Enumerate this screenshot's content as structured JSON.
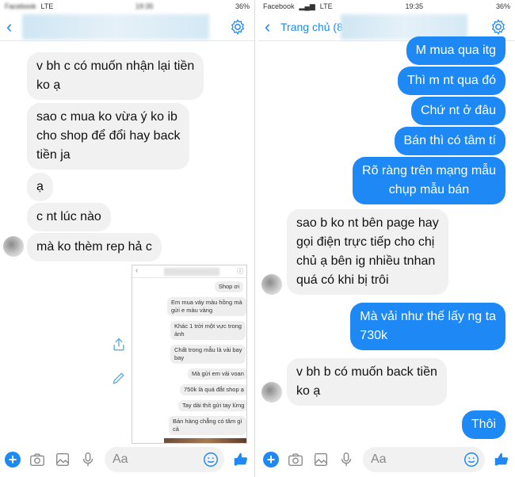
{
  "left": {
    "status": {
      "carrier": "Facebook",
      "network": "LTE",
      "time": "19:35",
      "battery": "36%"
    },
    "messages": [
      {
        "text": [
          "v bh c có muốn nhận lại tiền",
          "ko ạ"
        ]
      },
      {
        "text": [
          "sao c mua ko vừa ý ko ib",
          "cho shop để đổi hay back",
          "tiền ja"
        ]
      },
      {
        "text": [
          "ạ"
        ]
      },
      {
        "text": [
          "c nt lúc nào"
        ]
      },
      {
        "text": [
          "mà ko thèm rep hả c"
        ]
      }
    ],
    "embedded_screenshot": {
      "messages": [
        "Shop ơi",
        "Em mua váy màu hồng mà",
        "gửi e màu vàng",
        "Khác 1 trời một vực trong",
        "ảnh",
        "Chất trong mẫu là vải bay",
        "bay",
        "Mà gửi em vải voan",
        "750k là quá đắt shop ạ",
        "Tay dài thít gửi tay lửng",
        "Bán hàng chẳng có tâm gì",
        "cả"
      ]
    },
    "composer": {
      "placeholder": "Aa"
    }
  },
  "right": {
    "status": {
      "carrier": "Facebook",
      "network": "LTE",
      "time": "19:35",
      "battery": "36%"
    },
    "header": {
      "back_label": "Trang chủ (8"
    },
    "messages": [
      {
        "dir": "out",
        "text": [
          "M mua qua itg"
        ]
      },
      {
        "dir": "out",
        "text": [
          "Thì m nt qua đó"
        ]
      },
      {
        "dir": "out",
        "text": [
          "Chứ nt ở đâu"
        ]
      },
      {
        "dir": "out",
        "text": [
          "Bán thì có tâm tí"
        ]
      },
      {
        "dir": "out",
        "text": [
          "Rõ ràng trên mạng mẫu",
          "chụp mẫu bán"
        ]
      },
      {
        "dir": "in",
        "text": [
          "sao b ko nt bên page hay",
          "gọi điện trực tiếp cho chị",
          "chủ ạ bên ig nhiều tnhan",
          "quá có khi bị trôi"
        ]
      },
      {
        "dir": "out",
        "text": [
          "Mà vải như thế lấy ng ta",
          "730k"
        ]
      },
      {
        "dir": "in",
        "text": [
          "v bh b có muốn back tiền",
          "ko ạ"
        ]
      },
      {
        "dir": "out",
        "text": [
          "Thôi"
        ]
      }
    ],
    "composer": {
      "placeholder": "Aa"
    }
  },
  "colors": {
    "accent": "#1e88f5",
    "incoming": "#f1f1f1"
  }
}
